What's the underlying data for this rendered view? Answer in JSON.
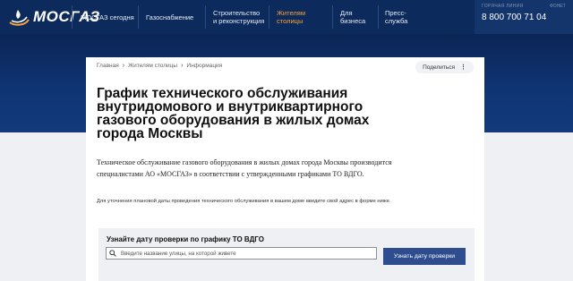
{
  "header": {
    "logo_text": "МОСГАЗ",
    "nav": [
      {
        "label": "МОСГАЗ сегодня",
        "active": false
      },
      {
        "label": "Газоснабжение",
        "active": false
      },
      {
        "label": "Строительство\nи реконструкция",
        "active": false
      },
      {
        "label": "Жителям\nстолицы",
        "active": true
      },
      {
        "label": "Для\nбизнеса",
        "active": false
      },
      {
        "label": "Пресс-\nслужба",
        "active": false
      }
    ],
    "phone_label": "ГОРЯЧАЯ ЛИНИЯ",
    "phone_label2": "ФОНЕТ",
    "phone": "8 800 700 71 04",
    "colors": {
      "bar": "#0d2a5c",
      "active": "#f7a23b"
    }
  },
  "breadcrumb": {
    "items": [
      "Главная",
      "Жителям столицы",
      "Информация"
    ]
  },
  "share_label": "Поделиться",
  "page": {
    "title": "График технического обслуживания внутридомового и внутриквартирного газового оборудования в жилых домах города Москвы",
    "lead": "Техническое обслуживание газового оборудования в жилых домах города Москвы производится специалистами АО «МОСГАЗ» в соответствии с утвержденными графиками ТО ВДГО.",
    "note": "Для уточнения плановой даты проведения технического обслуживания в вашем доме введите свой адрес в форме ниже."
  },
  "form": {
    "title": "Узнайте дату проверки по графику ТО ВДГО",
    "placeholder": "Введите название улицы, на которой живете",
    "button": "Узнать дату проверки"
  }
}
